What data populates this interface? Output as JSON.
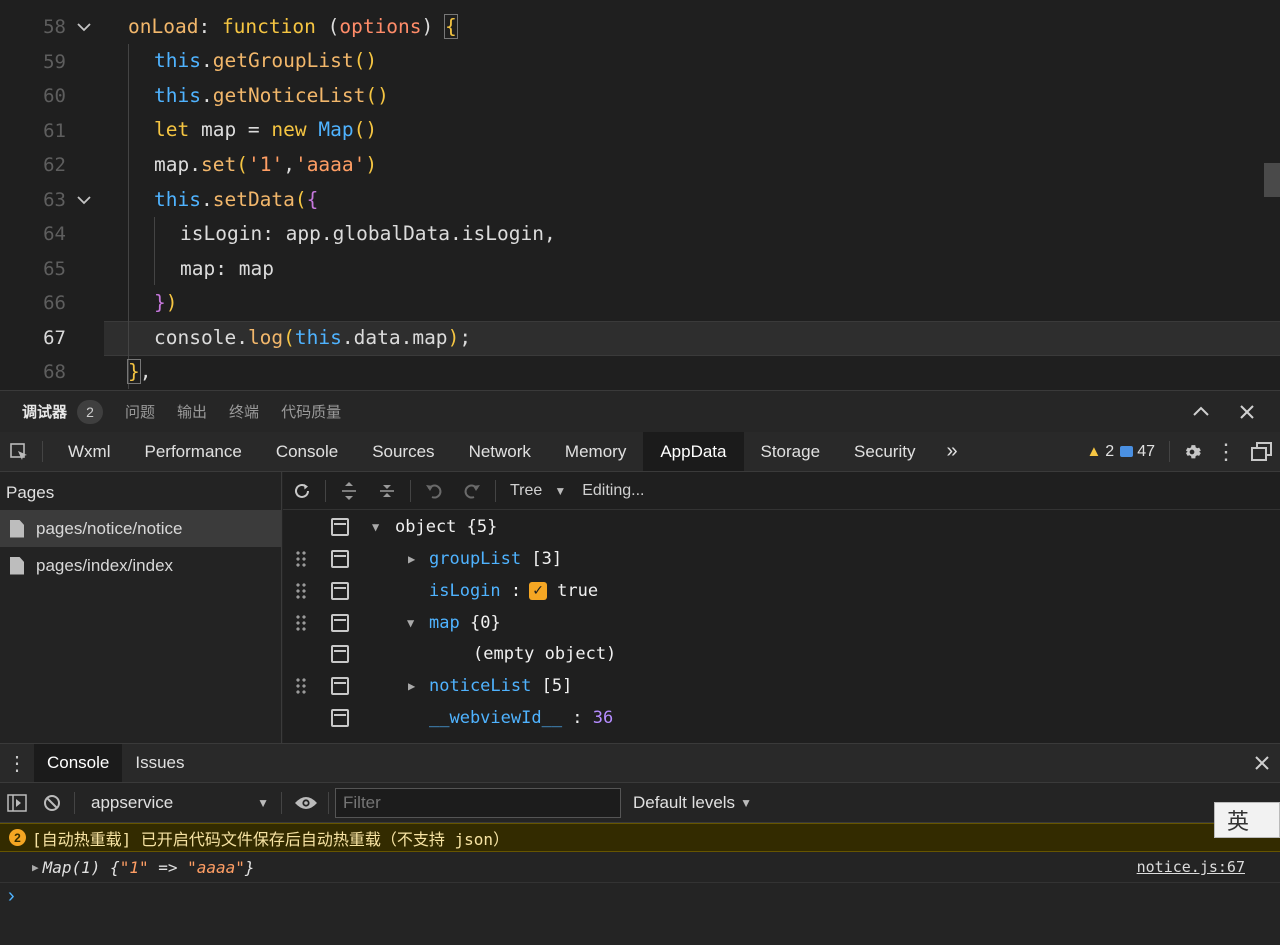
{
  "editor": {
    "lines": [
      {
        "num": "58",
        "fold": true
      },
      {
        "num": "59"
      },
      {
        "num": "60"
      },
      {
        "num": "61"
      },
      {
        "num": "62"
      },
      {
        "num": "63",
        "fold": true
      },
      {
        "num": "64"
      },
      {
        "num": "65"
      },
      {
        "num": "66"
      },
      {
        "num": "67",
        "active": true
      },
      {
        "num": "68"
      }
    ],
    "code": {
      "l58": {
        "a": "onLoad",
        "b": ": ",
        "c": "function",
        "d": " (",
        "e": "options",
        "f": ") ",
        "g": "{"
      },
      "l59": {
        "a": "this",
        "b": ".",
        "c": "getGroupList",
        "d": "()"
      },
      "l60": {
        "a": "this",
        "b": ".",
        "c": "getNoticeList",
        "d": "()"
      },
      "l61": {
        "a": "let",
        "b": " map = ",
        "c": "new",
        "d": " ",
        "e": "Map",
        "f": "()"
      },
      "l62": {
        "a": "map",
        "b": ".",
        "c": "set",
        "d": "(",
        "e": "'1'",
        "f": ",",
        "g": "'aaaa'",
        "h": ")"
      },
      "l63": {
        "a": "this",
        "b": ".",
        "c": "setData",
        "d": "(",
        "e": "{"
      },
      "l64": {
        "a": "isLogin",
        "b": ": app.globalData.isLogin,"
      },
      "l65": {
        "a": "map",
        "b": ": map"
      },
      "l66": {
        "a": "}",
        "b": ")"
      },
      "l67": {
        "a": "console",
        "b": ".",
        "c": "log",
        "d": "(",
        "e": "this",
        "f": ".data.map",
        "g": ")",
        "h": ";"
      },
      "l68": {
        "a": "}",
        "b": ","
      }
    }
  },
  "panel_tabs": {
    "debugger": "调试器",
    "debugger_count": "2",
    "issues": "问题",
    "output": "输出",
    "terminal": "终端",
    "code_quality": "代码质量"
  },
  "devtools_tabs": [
    "Wxml",
    "Performance",
    "Console",
    "Sources",
    "Network",
    "Memory",
    "AppData",
    "Storage",
    "Security"
  ],
  "devtools_more": "»",
  "status": {
    "warnings": "2",
    "messages": "47"
  },
  "pages": {
    "header": "Pages",
    "items": [
      "pages/notice/notice",
      "pages/index/index"
    ]
  },
  "appdata_toolbar": {
    "view": "Tree",
    "mode": "Editing..."
  },
  "tree": {
    "root_key": "object",
    "root_val": "{5}",
    "groupList_key": "groupList",
    "groupList_val": "[3]",
    "isLogin_key": "isLogin",
    "isLogin_val": "true",
    "map_key": "map",
    "map_val": "{0}",
    "empty": "(empty object)",
    "noticeList_key": "noticeList",
    "noticeList_val": "[5]",
    "webview_key": "__webviewId__",
    "webview_val": "36"
  },
  "console": {
    "tabs": [
      "Console",
      "Issues"
    ],
    "context": "appservice",
    "filter_placeholder": "Filter",
    "levels": "Default levels",
    "warn_count": "2",
    "warn_text": "[自动热重载] 已开启代码文件保存后自动热重载（不支持 json）",
    "log_prefix": "Map(1) {",
    "log_key": "\"1\"",
    "log_arrow": " => ",
    "log_val": "\"aaaa\"",
    "log_suffix": "}",
    "log_source": "notice.js:67",
    "prompt": "›"
  },
  "ime_label": "英"
}
